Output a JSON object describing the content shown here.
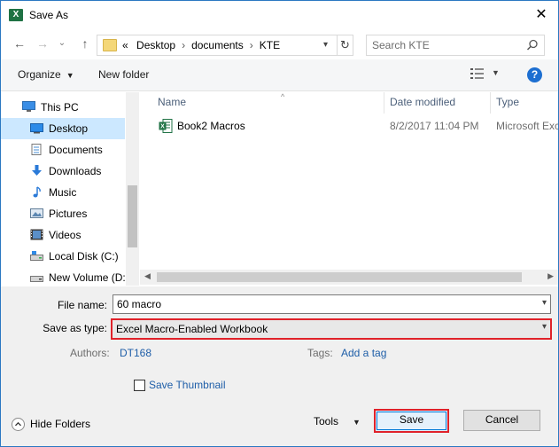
{
  "window": {
    "title": "Save As",
    "app_icon_letter": "X",
    "close_glyph": "✕"
  },
  "nav": {
    "back_glyph": "←",
    "forward_glyph": "→",
    "recent_glyph": "⌄",
    "up_glyph": "↑",
    "breadcrumb_prefix": "«",
    "breadcrumbs": [
      "Desktop",
      "documents",
      "KTE"
    ],
    "crumb_separator": "›",
    "search_placeholder": "Search KTE"
  },
  "toolbar": {
    "organize_label": "Organize",
    "new_folder_label": "New folder",
    "help_label": "?"
  },
  "sidebar": {
    "items": [
      {
        "label": "This PC",
        "icon": "computer-icon",
        "selected": false
      },
      {
        "label": "Desktop",
        "icon": "desktop-icon",
        "selected": true
      },
      {
        "label": "Documents",
        "icon": "documents-icon",
        "selected": false
      },
      {
        "label": "Downloads",
        "icon": "downloads-icon",
        "selected": false
      },
      {
        "label": "Music",
        "icon": "music-icon",
        "selected": false
      },
      {
        "label": "Pictures",
        "icon": "pictures-icon",
        "selected": false
      },
      {
        "label": "Videos",
        "icon": "videos-icon",
        "selected": false
      },
      {
        "label": "Local Disk (C:)",
        "icon": "drive-icon",
        "selected": false
      },
      {
        "label": "New Volume (D:",
        "icon": "drive-icon",
        "selected": false
      }
    ]
  },
  "file_list": {
    "columns": [
      "Name",
      "Date modified",
      "Type"
    ],
    "rows": [
      {
        "name": "Book2 Macros",
        "date_modified": "8/2/2017 11:04 PM",
        "type": "Microsoft Exc",
        "icon": "excel-file-icon"
      }
    ]
  },
  "form": {
    "file_name_label": "File name:",
    "file_name_value": "60 macro",
    "save_type_label": "Save as type:",
    "save_type_value": "Excel Macro-Enabled Workbook",
    "authors_label": "Authors:",
    "authors_value": "DT168",
    "tags_label": "Tags:",
    "tags_value": "Add a tag",
    "thumbnail_label": "Save Thumbnail",
    "thumbnail_checked": false
  },
  "footer": {
    "hide_folders_label": "Hide Folders",
    "tools_label": "Tools",
    "save_label": "Save",
    "cancel_label": "Cancel"
  },
  "colors": {
    "highlight_border": "#e0222a",
    "selected_item": "#cce8ff",
    "link": "#1e5ea8",
    "excel_green": "#1f7244"
  }
}
